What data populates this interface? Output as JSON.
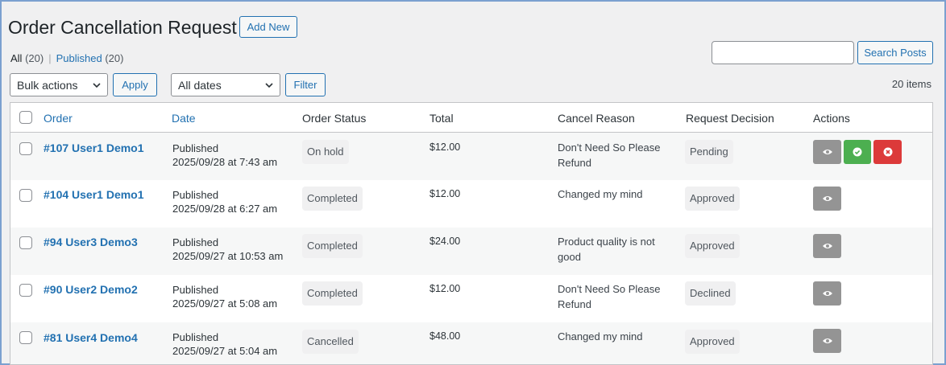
{
  "page": {
    "title": "Order Cancellation Request",
    "add_new": "Add New"
  },
  "filters_nav": {
    "all_label": "All",
    "all_count": "(20)",
    "separator": "|",
    "published_label": "Published",
    "published_count": "(20)"
  },
  "search": {
    "value": "",
    "button": "Search Posts"
  },
  "toolbar": {
    "bulk_actions": "Bulk actions",
    "apply": "Apply",
    "dates": "All dates",
    "filter": "Filter",
    "items_count": "20 items"
  },
  "columns": {
    "order": "Order",
    "date": "Date",
    "status": "Order Status",
    "total": "Total",
    "reason": "Cancel Reason",
    "decision": "Request Decision",
    "actions": "Actions"
  },
  "rows": [
    {
      "order": "#107 User1 Demo1",
      "date_status": "Published",
      "date": "2025/09/28 at 7:43 am",
      "status": "On hold",
      "total": "$12.00",
      "reason": "Don't Need So Please Refund",
      "decision": "Pending"
    },
    {
      "order": "#104 User1 Demo1",
      "date_status": "Published",
      "date": "2025/09/28 at 6:27 am",
      "status": "Completed",
      "total": "$12.00",
      "reason": "Changed my mind",
      "decision": "Approved"
    },
    {
      "order": "#94 User3 Demo3",
      "date_status": "Published",
      "date": "2025/09/27 at 10:53 am",
      "status": "Completed",
      "total": "$24.00",
      "reason": "Product quality is not good",
      "decision": "Approved"
    },
    {
      "order": "#90 User2 Demo2",
      "date_status": "Published",
      "date": "2025/09/27 at 5:08 am",
      "status": "Completed",
      "total": "$12.00",
      "reason": "Don't Need So Please Refund",
      "decision": "Declined"
    },
    {
      "order": "#81 User4 Demo4",
      "date_status": "Published",
      "date": "2025/09/27 at 5:04 am",
      "status": "Cancelled",
      "total": "$48.00",
      "reason": "Changed my mind",
      "decision": "Approved"
    }
  ],
  "colors": {
    "accent": "#2271b1",
    "view_button": "#949494",
    "approve_button": "#4caf50",
    "reject_button": "#dc3a3a"
  },
  "icons": {
    "view": "eye-icon",
    "approve": "check-circle-icon",
    "reject": "x-circle-icon",
    "select": "chevron-down-icon"
  }
}
